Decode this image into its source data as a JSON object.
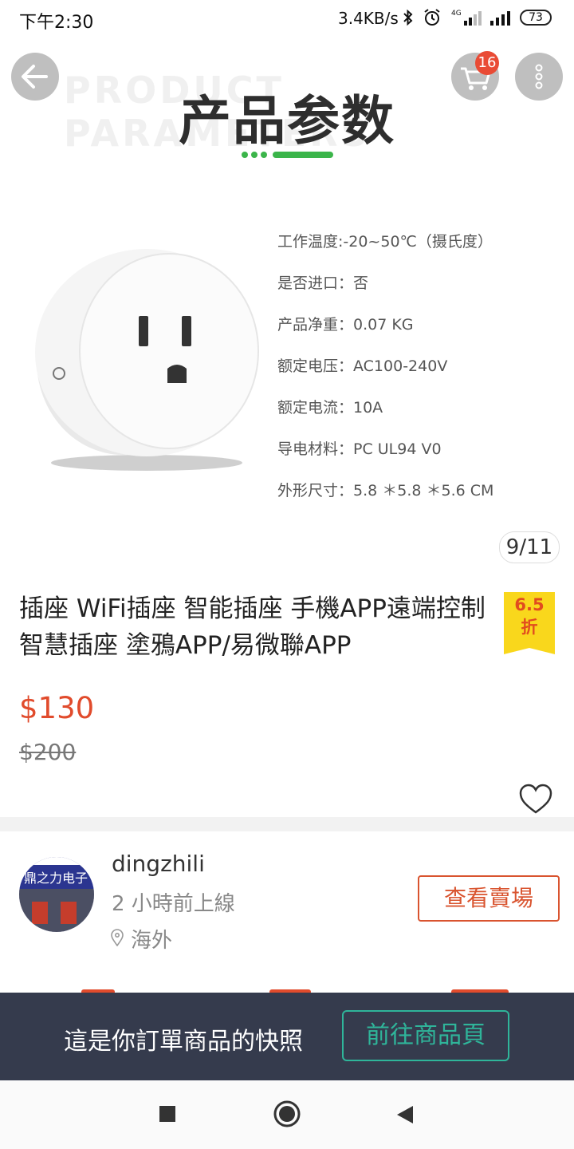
{
  "status_bar": {
    "time": "下午2:30",
    "speed": "3.4KB/s",
    "battery": "73"
  },
  "hero": {
    "watermark": "PRODUCT PARAMETERS",
    "title": "产品参数",
    "specs": [
      "工作温度:-20~50℃（摄氏度）",
      "是否进口：否",
      "产品净重：0.07 KG",
      "额定电压：AC100-240V",
      "额定电流：10A",
      "导电材料：PC UL94 V0",
      "外形尺寸：5.8 ＊5.8 ＊5.6 CM"
    ],
    "page_counter": "9/11"
  },
  "header": {
    "cart_count": "16"
  },
  "product": {
    "title": "插座 WiFi插座 智能插座 手機APP遠端控制 智慧插座 塗鴉APP/易微聯APP",
    "discount_value": "6.5",
    "discount_unit": "折",
    "price": "$130",
    "original_price": "$200"
  },
  "seller": {
    "avatar_text": "鼎之力电子",
    "name": "dingzhili",
    "online": "2 小時前上線",
    "location": "海外",
    "view_store": "查看賣場"
  },
  "snapshot": {
    "text": "這是你訂單商品的快照",
    "button": "前往商品頁"
  },
  "colors": {
    "accent": "#e14b2c",
    "snapshot_bg": "#353b4d",
    "teal": "#2fb59a",
    "discount_bg": "#f9d71c"
  }
}
